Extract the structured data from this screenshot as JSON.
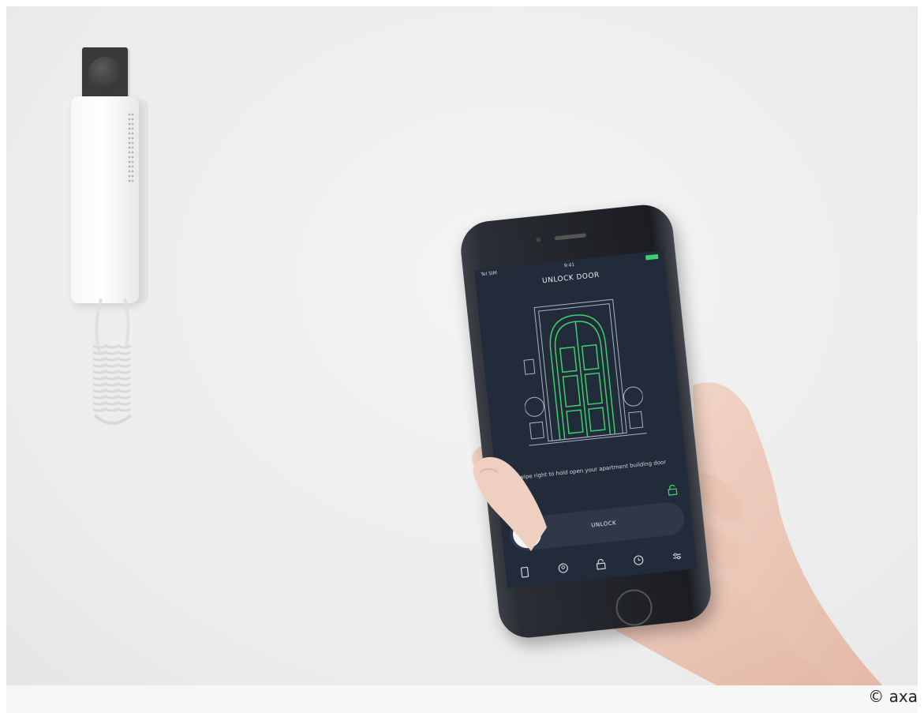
{
  "phone_screen": {
    "status_left": "Tel SIM",
    "status_time": "9:41",
    "title": "UNLOCK DOOR",
    "swipe_text": "Swipe right to hold open your apartment building door",
    "unlock_label": "UNLOCK"
  },
  "credit": "© axa",
  "colors": {
    "screen_bg": "#222b39",
    "accent_green": "#3ccf6e",
    "wall": "#ececec"
  },
  "icons": [
    "lock-icon",
    "unlock-icon",
    "chevron-right-icon",
    "phone-tab-icon",
    "id-tab-icon",
    "lock-tab-icon",
    "clock-tab-icon",
    "settings-tab-icon"
  ]
}
